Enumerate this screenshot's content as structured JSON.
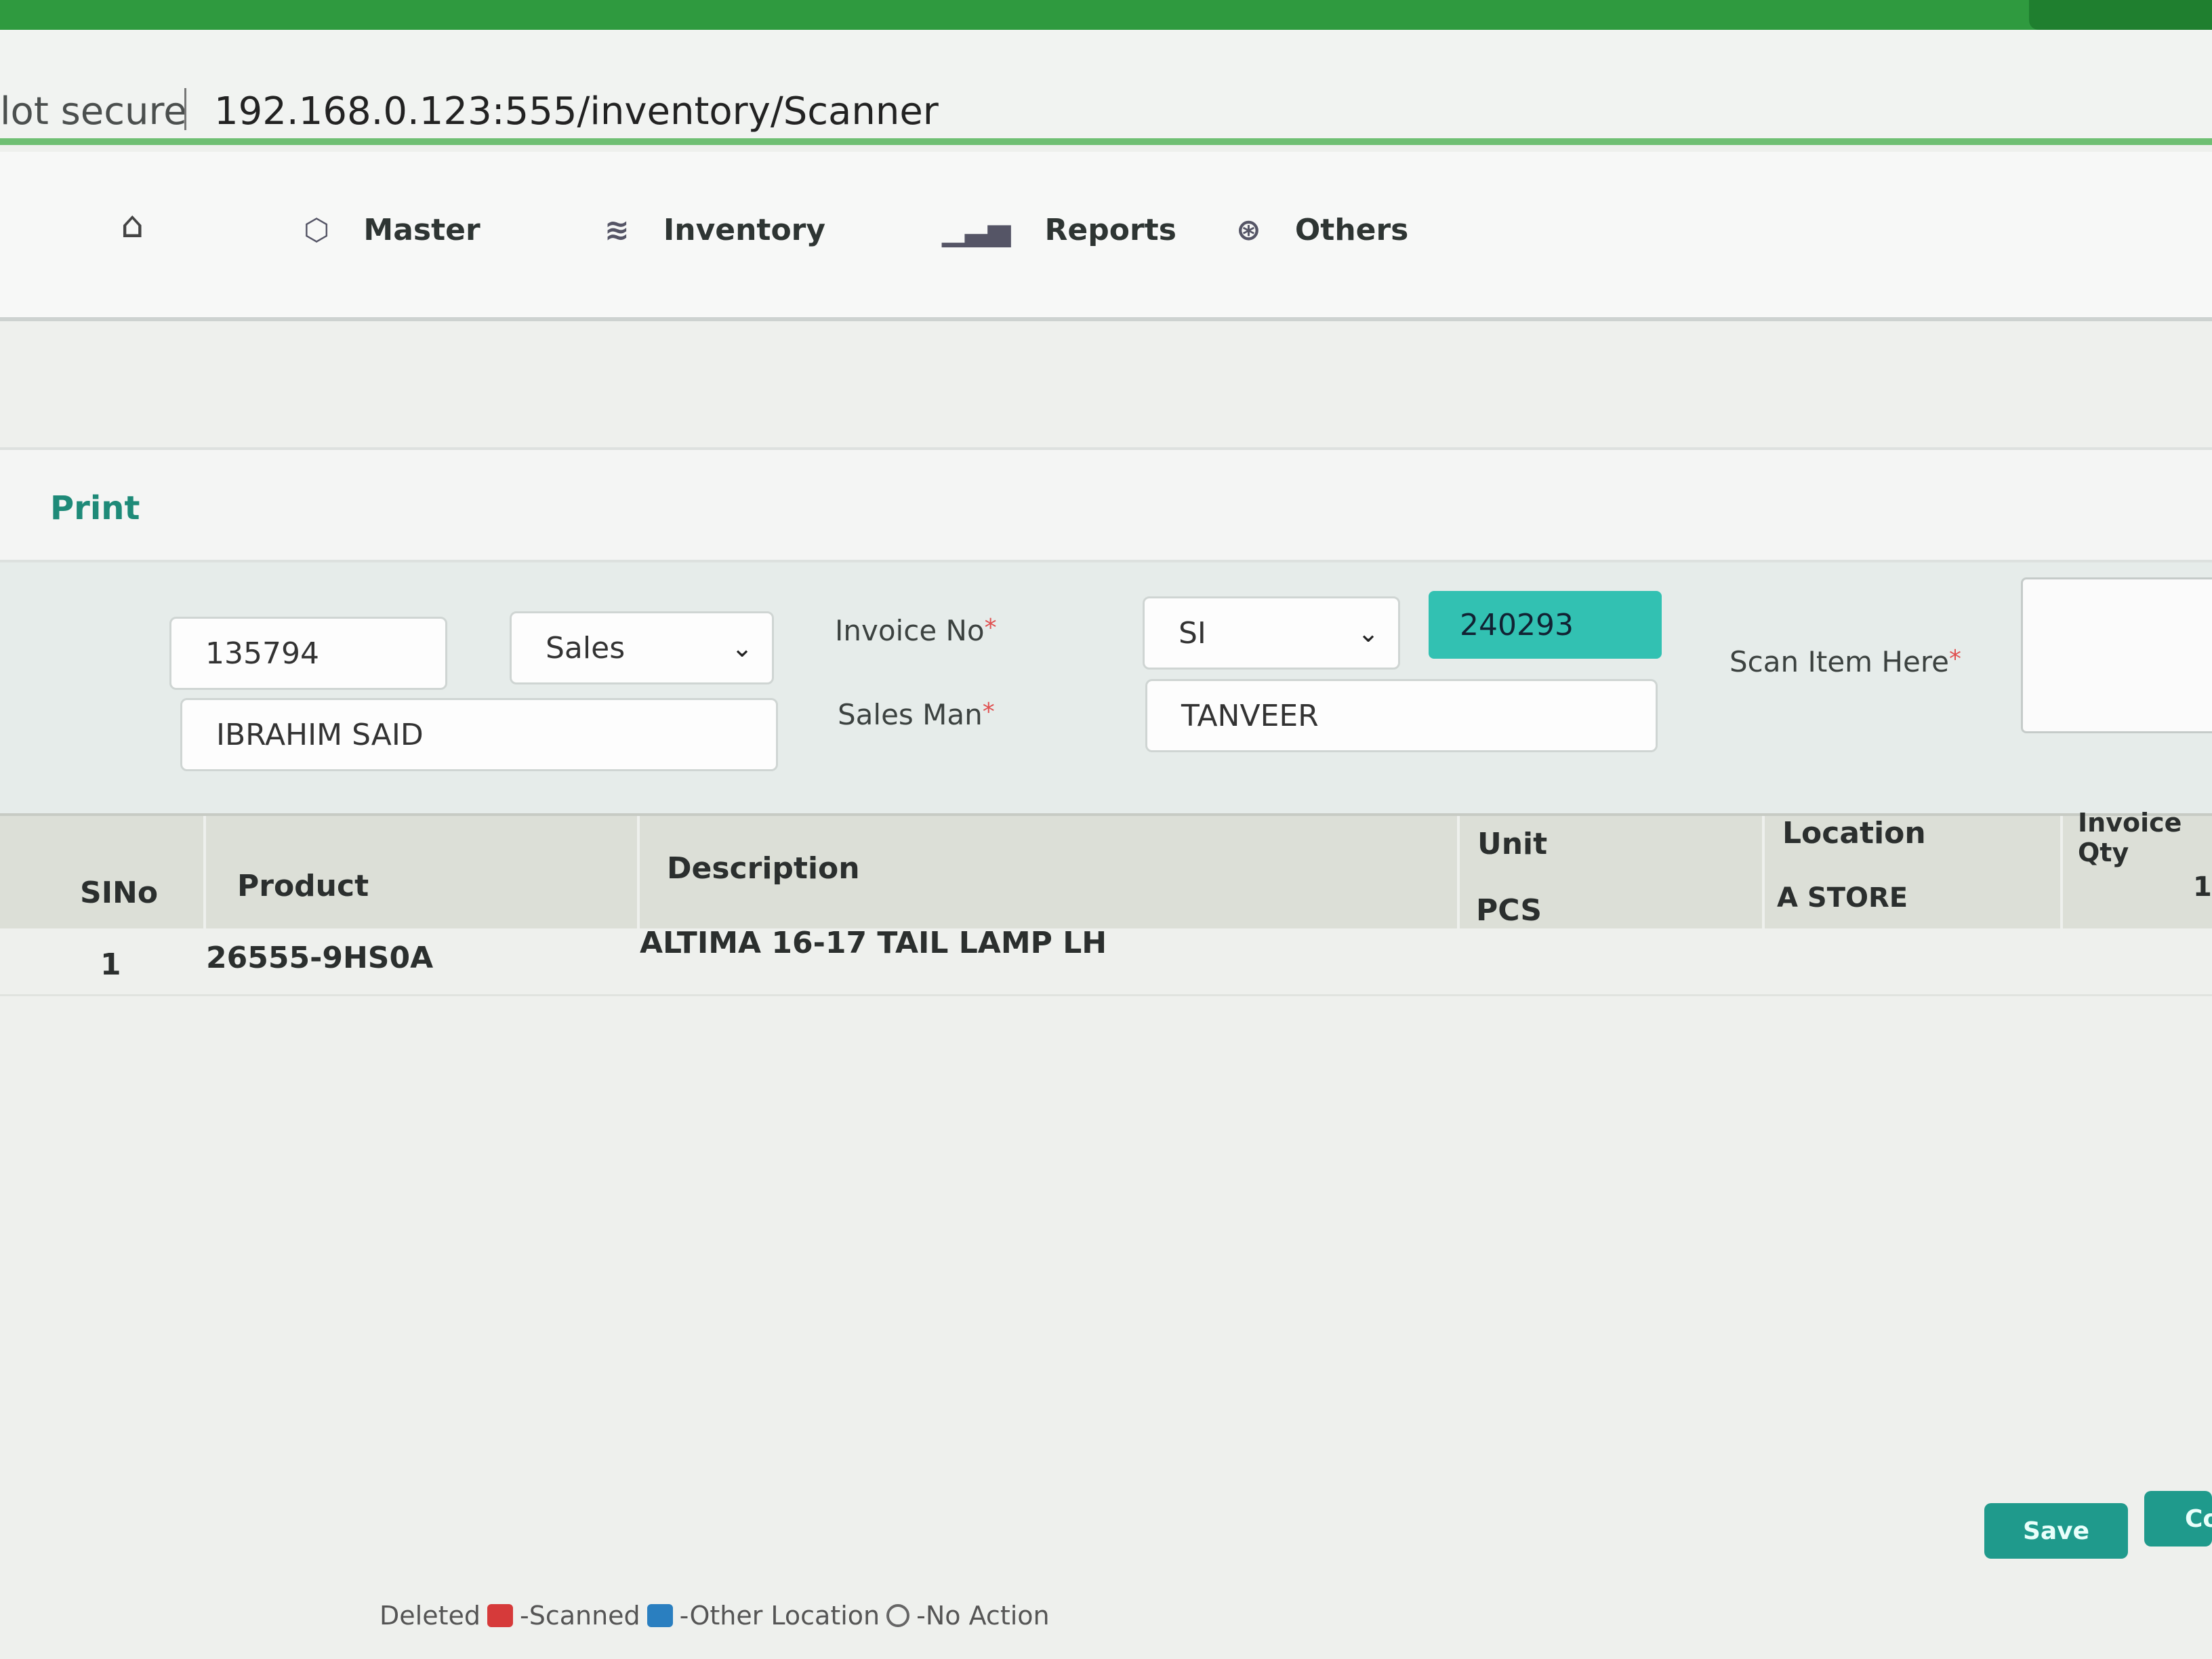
{
  "browser": {
    "security_label": "lot secure",
    "url": "192.168.0.123:555/inventory/Scanner"
  },
  "nav": {
    "home_icon": "home-icon",
    "items": [
      {
        "label": "Master",
        "icon": "cube-icon"
      },
      {
        "label": "Inventory",
        "icon": "layers-icon"
      },
      {
        "label": "Reports",
        "icon": "bar-chart-icon"
      },
      {
        "label": "Others",
        "icon": "globe-icon"
      }
    ]
  },
  "toolbar": {
    "print_label": "Print"
  },
  "form": {
    "customer_code": "135794",
    "type_select": "Sales",
    "customer_name": "IBRAHIM SAID",
    "invoice_label": "Invoice No",
    "invoice_prefix": "SI",
    "invoice_number": "240293",
    "salesman_label": "Sales Man",
    "salesman": "TANVEER",
    "scan_label": "Scan Item Here",
    "required_mark": "*"
  },
  "table": {
    "headers": [
      "SINo",
      "Product",
      "Description",
      "Unit",
      "Location",
      "Invoice Qty"
    ],
    "rows": [
      {
        "sino": "1",
        "product": "26555-9HS0A",
        "description": "ALTIMA 16-17 TAIL LAMP LH",
        "unit": "PCS",
        "location": "A STORE",
        "qty": "1"
      }
    ]
  },
  "buttons": {
    "save": "Save",
    "second": "Co"
  },
  "legend": {
    "deleted": "Deleted",
    "scanned": "-Scanned",
    "other_location": "-Other Location",
    "no_action": "-No Action",
    "colors": {
      "scanned": "#d63a3a",
      "other_location": "#2a7fc0"
    }
  }
}
